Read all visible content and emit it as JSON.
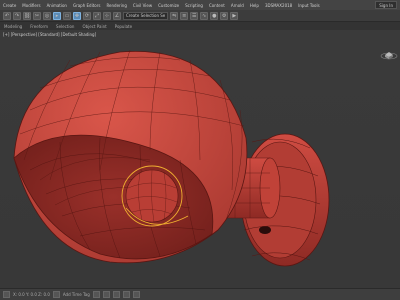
{
  "menu": {
    "items": [
      "Create",
      "Modifiers",
      "Animation",
      "Graph Editors",
      "Rendering",
      "Civil View",
      "Customize",
      "Scripting",
      "Content",
      "Arnold",
      "Help",
      "3DSMAX2018",
      "Input Tools"
    ],
    "sign_in": "Sign In"
  },
  "toolbar": {
    "selection_set": "Create Selection Se"
  },
  "ribbon": {
    "tabs": [
      "Modeling",
      "Freeform",
      "Selection",
      "Object Paint",
      "Populate"
    ]
  },
  "viewport": {
    "label": "[+] [Perspective] [Standard] [Default Shading]"
  },
  "status": {
    "coords": "X: 0.0  Y: 0.0  Z: 0.0",
    "time_tag": "Add Time Tag"
  },
  "colors": {
    "model": "#c8463c",
    "model_dark": "#8e2a24",
    "wire": "#5a1612",
    "selection": "#f0b030"
  }
}
